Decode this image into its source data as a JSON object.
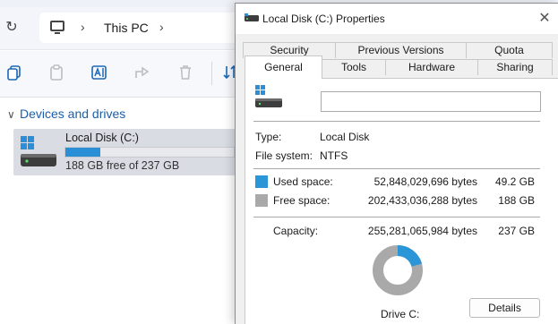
{
  "explorer": {
    "breadcrumb": {
      "location": "This PC"
    },
    "section": {
      "title": "Devices and drives"
    },
    "drive": {
      "name": "Local Disk (C:)",
      "free_text": "188 GB free of 237 GB",
      "used_fraction": 0.207
    },
    "toolbar": [
      "copy-icon",
      "paste-icon",
      "rename-icon",
      "share-icon",
      "delete-icon",
      "sort-icon"
    ]
  },
  "dialog": {
    "title": "Local Disk (C:) Properties",
    "tabs_row1": [
      "Security",
      "Previous Versions",
      "Quota"
    ],
    "tabs_row2": [
      "General",
      "Tools",
      "Hardware",
      "Sharing"
    ],
    "active_tab": "General",
    "name_value": "",
    "type_label": "Type:",
    "type_value": "Local Disk",
    "fs_label": "File system:",
    "fs_value": "NTFS",
    "used": {
      "label": "Used space:",
      "bytes": "52,848,029,696 bytes",
      "size": "49.2 GB",
      "color": "#2a96d8"
    },
    "free": {
      "label": "Free space:",
      "bytes": "202,433,036,288 bytes",
      "size": "188 GB",
      "color": "#a9a9a9"
    },
    "capacity": {
      "label": "Capacity:",
      "bytes": "255,281,065,984 bytes",
      "size": "237 GB"
    },
    "drive_caption": "Drive C:",
    "details_label": "Details",
    "used_fraction": 0.207
  }
}
